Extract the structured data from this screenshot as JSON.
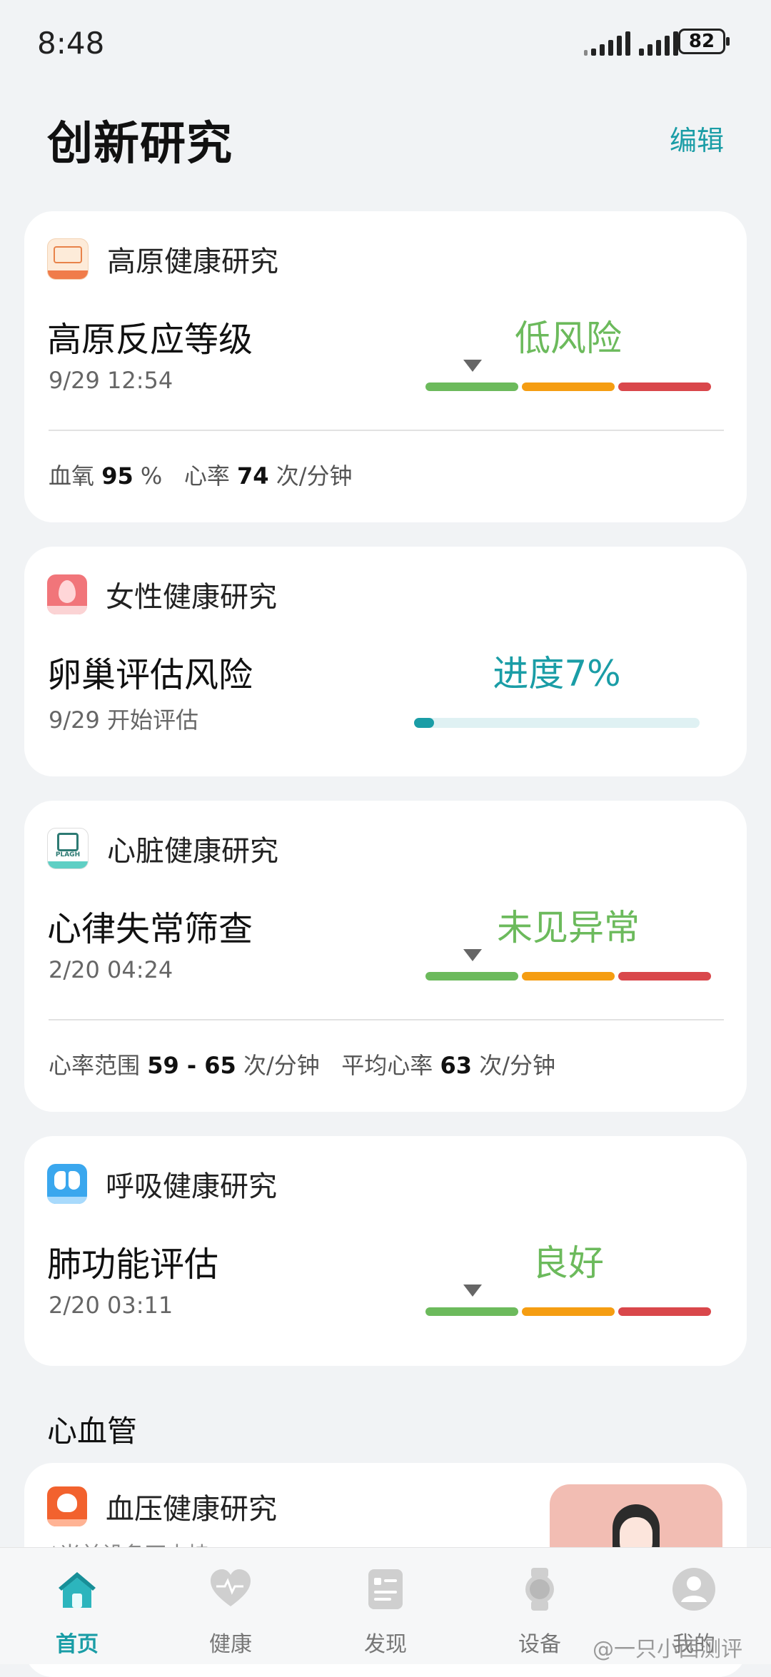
{
  "status_bar": {
    "time": "8:48",
    "battery": "82"
  },
  "header": {
    "title": "创新研究",
    "edit_label": "编辑"
  },
  "cards": [
    {
      "category": "高原健康研究",
      "metric": "高原反应等级",
      "time": "9/29 12:54",
      "result": "低风险",
      "result_color": "#6cba5c",
      "risk_level": "low",
      "footer": {
        "l1": "血氧",
        "v1": "95",
        "u1": "%",
        "l2": "心率",
        "v2": "74",
        "u2": "次/分钟"
      }
    },
    {
      "category": "女性健康研究",
      "metric": "卵巢评估风险",
      "time": "9/29 开始评估",
      "result": "进度7%",
      "result_color": "#1a9da6",
      "progress": 0.07
    },
    {
      "category": "心脏健康研究",
      "metric": "心律失常筛查",
      "time": "2/20 04:24",
      "result": "未见异常",
      "result_color": "#6cba5c",
      "risk_level": "low",
      "icon_text": "PLAGH",
      "footer": {
        "l1": "心率范围",
        "v1": "59 - 65",
        "u1": "次/分钟",
        "l2": "平均心率",
        "v2": "63",
        "u2": "次/分钟"
      }
    },
    {
      "category": "呼吸健康研究",
      "metric": "肺功能评估",
      "time": "2/20 03:11",
      "result": "良好",
      "result_color": "#6cba5c",
      "risk_level": "low"
    }
  ],
  "section": {
    "title": "心血管"
  },
  "bp_card": {
    "category": "血压健康研究",
    "subtitle": "*当前设备不支持"
  },
  "risk_colors": [
    "#6cba5c",
    "#f59d12",
    "#d9474b"
  ],
  "tabs": [
    {
      "label": "首页",
      "icon": "home-icon",
      "active": true
    },
    {
      "label": "健康",
      "icon": "heart-pulse-icon",
      "active": false
    },
    {
      "label": "发现",
      "icon": "discover-icon",
      "active": false
    },
    {
      "label": "设备",
      "icon": "watch-icon",
      "active": false
    },
    {
      "label": "我的",
      "icon": "profile-icon",
      "active": false
    }
  ],
  "watermark": "@一只小西测评"
}
